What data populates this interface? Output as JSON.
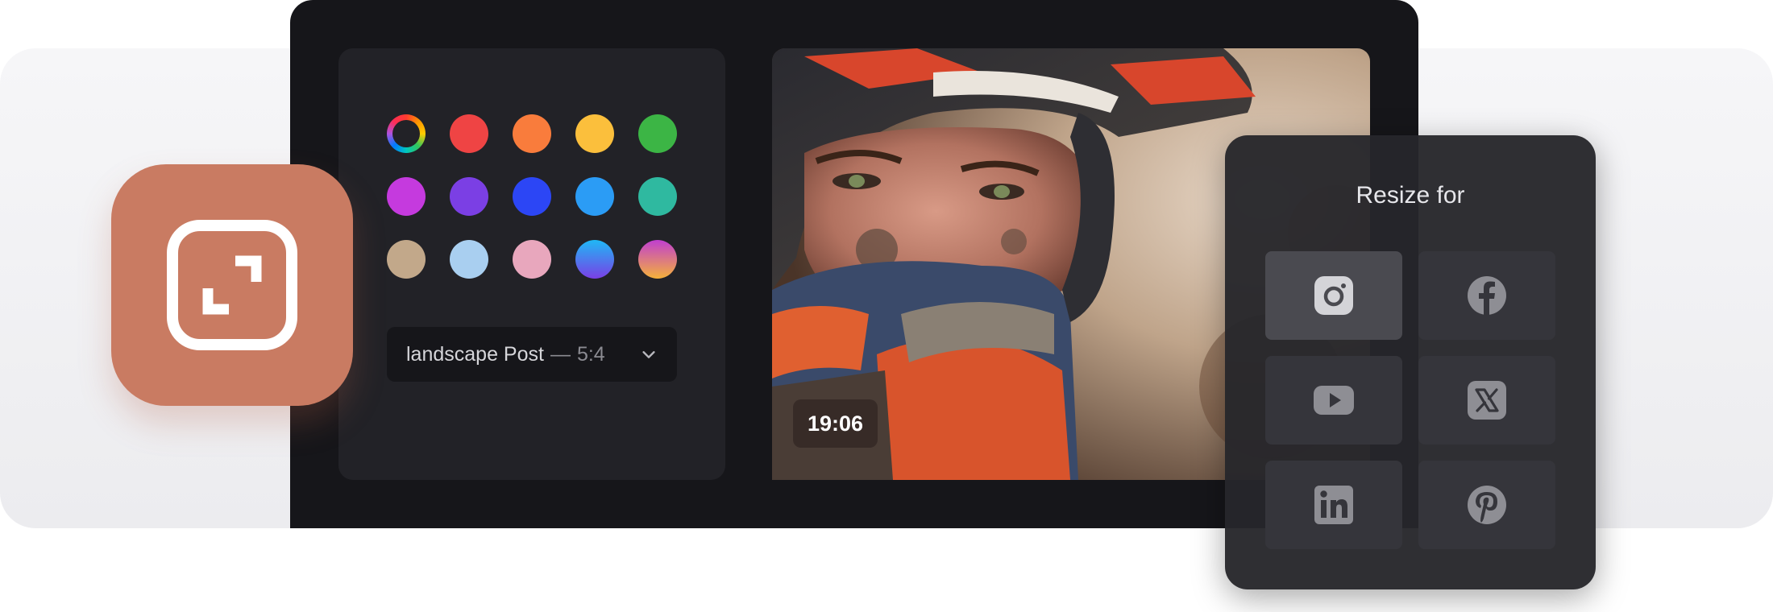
{
  "palette": {
    "colors": [
      {
        "name": "custom-color-wheel",
        "color": "conic"
      },
      {
        "name": "red",
        "color": "#ef4444"
      },
      {
        "name": "orange",
        "color": "#f97c3c"
      },
      {
        "name": "yellow",
        "color": "#fbbf3c"
      },
      {
        "name": "green",
        "color": "#3cb545"
      },
      {
        "name": "magenta",
        "color": "#c53ade"
      },
      {
        "name": "purple",
        "color": "#7b3fe4"
      },
      {
        "name": "blue",
        "color": "#2c46f5"
      },
      {
        "name": "sky-blue",
        "color": "#2b9cf5"
      },
      {
        "name": "teal",
        "color": "#2fb9a0"
      },
      {
        "name": "beige",
        "color": "#c2a88a"
      },
      {
        "name": "light-blue",
        "color": "#a9cff0"
      },
      {
        "name": "pink",
        "color": "#e8a7bd"
      },
      {
        "name": "blue-purple-gradient",
        "color": "linear-gradient(180deg,#1fb8f5,#7a3fe6)"
      },
      {
        "name": "pink-orange-gradient",
        "color": "linear-gradient(180deg,#c03fd0,#f5b13a)"
      }
    ]
  },
  "format_select": {
    "name": "landscape Post",
    "separator": "—",
    "ratio": "5:4"
  },
  "photo": {
    "timestamp": "19:06"
  },
  "resize": {
    "title": "Resize for",
    "targets": [
      {
        "name": "instagram",
        "icon": "instagram-icon",
        "active": true
      },
      {
        "name": "facebook",
        "icon": "facebook-icon",
        "active": false
      },
      {
        "name": "youtube",
        "icon": "youtube-icon",
        "active": false
      },
      {
        "name": "x",
        "icon": "x-icon",
        "active": false
      },
      {
        "name": "linkedin",
        "icon": "linkedin-icon",
        "active": false
      },
      {
        "name": "pinterest",
        "icon": "pinterest-icon",
        "active": false
      }
    ]
  },
  "colors": {
    "app_icon": "#c97b62",
    "frame": "#16161a",
    "panel": "#222227"
  }
}
